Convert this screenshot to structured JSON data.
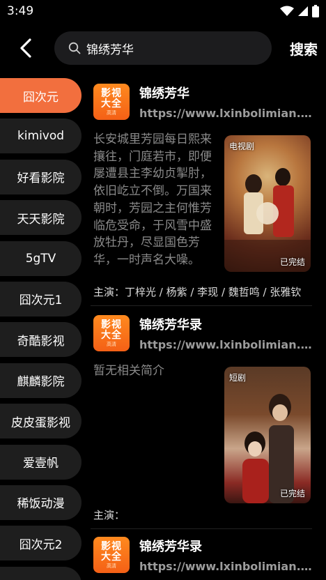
{
  "status_bar": {
    "time": "3:49"
  },
  "search": {
    "query": "锦绣芳华",
    "action_label": "搜索"
  },
  "sidebar": {
    "items": [
      {
        "label": "囧次元",
        "active": true
      },
      {
        "label": "kimivod"
      },
      {
        "label": "好看影院"
      },
      {
        "label": "天天影院"
      },
      {
        "label": "5gTV"
      },
      {
        "label": "囧次元1"
      },
      {
        "label": "奇酷影视"
      },
      {
        "label": "麒麟影院"
      },
      {
        "label": "皮皮蛋影视"
      },
      {
        "label": "爱壹帆"
      },
      {
        "label": "稀饭动漫"
      },
      {
        "label": "囧次元2"
      },
      {
        "label": ""
      }
    ]
  },
  "app_logo": {
    "line1": "影视",
    "line2": "大全",
    "line3": "高清"
  },
  "results": [
    {
      "title": "锦绣芳华",
      "url": "https://www.lxinbolimian.com",
      "description": "长安城里芳园每日熙来攘往，门庭若市，即便屡遭县主李幼贞掣肘，依旧屹立不倒。万国来朝时，芳园之主何惟芳临危受命，于风雪中盛放牡丹，尽显国色芳华，一时声名大噪。",
      "poster_tag": "电视剧",
      "poster_status": "已完结",
      "cast": "主演：丁梓光 / 杨紫 / 李现 / 魏哲鸣 / 张雅钦"
    },
    {
      "title": "锦绣芳华录",
      "url": "https://www.lxinbolimian.com",
      "description": "暂无相关简介",
      "poster_tag": "短剧",
      "poster_status": "已完结",
      "cast": "主演："
    },
    {
      "title": "锦绣芳华录",
      "url": "https://www.lxinbolimian.com"
    }
  ]
}
